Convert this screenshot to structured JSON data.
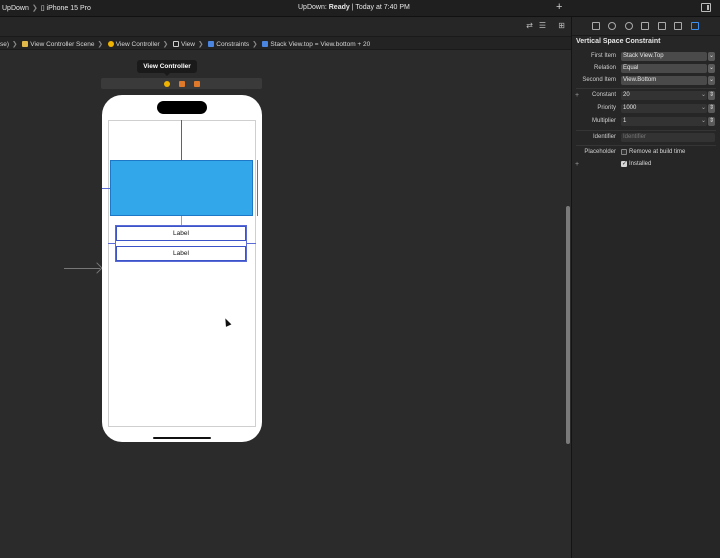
{
  "toolbar": {
    "scheme_left": "UpDown",
    "device": "iPhone 15 Pro",
    "status_app": "UpDown:",
    "status_state": "Ready",
    "status_time": "| Today at 7:40 PM",
    "add_label": "+"
  },
  "breadcrumbs": [
    {
      "label": "se)",
      "color": ""
    },
    {
      "label": "View Controller Scene",
      "color": "#e0b84a"
    },
    {
      "label": "View Controller",
      "color": "#f0b400"
    },
    {
      "label": "View",
      "color": "#cfcfcf"
    },
    {
      "label": "Constraints",
      "color": "#4a86e0"
    },
    {
      "label": "Stack View.top = View.bottom + 20",
      "color": "#4a86e0"
    }
  ],
  "canvas": {
    "scene_title": "View Controller",
    "label_1": "Label",
    "label_2": "Label"
  },
  "inspector": {
    "title": "Vertical Space Constraint",
    "first_item_label": "First Item",
    "first_item_value": "Stack View.Top",
    "relation_label": "Relation",
    "relation_value": "Equal",
    "second_item_label": "Second Item",
    "second_item_value": "View.Bottom",
    "constant_label": "Constant",
    "constant_value": "20",
    "priority_label": "Priority",
    "priority_value": "1000",
    "multiplier_label": "Multiplier",
    "multiplier_value": "1",
    "identifier_label": "Identifier",
    "identifier_placeholder": "Identifier",
    "placeholder_label": "Placeholder",
    "remove_at_build": "Remove at build time",
    "installed": "Installed"
  },
  "colors": {
    "accent": "#3b8ff0",
    "view_blue": "#32a8ea",
    "constraint": "#3b55c8"
  }
}
